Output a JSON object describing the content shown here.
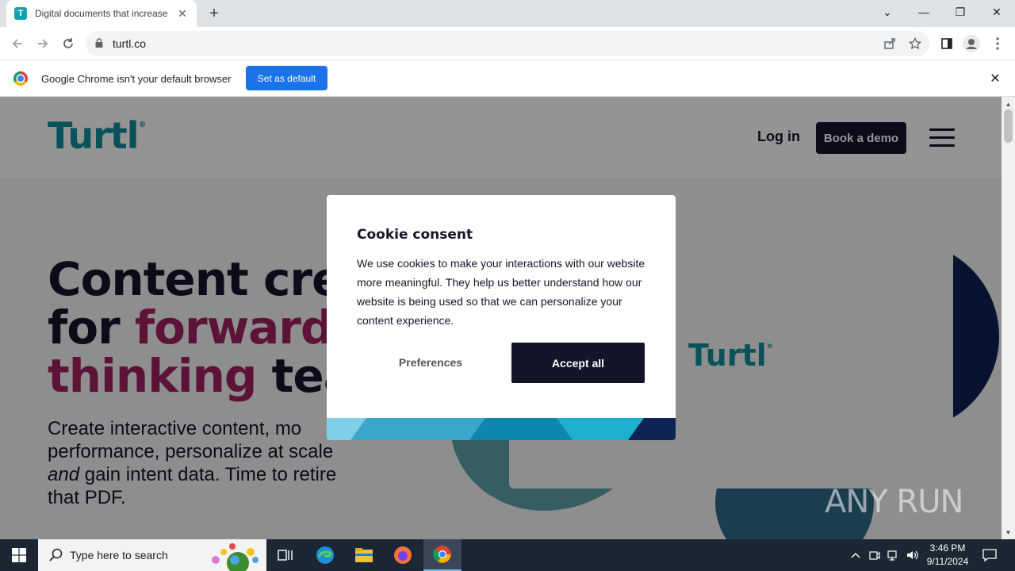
{
  "browser": {
    "tab": {
      "favicon_letter": "T",
      "title": "Digital documents that increase",
      "close": "✕"
    },
    "new_tab": "+",
    "window_controls": {
      "minimize": "—",
      "maximize": "❐",
      "close": "✕",
      "tab_search": "⌄"
    },
    "url": "turtl.co"
  },
  "infobar": {
    "message": "Google Chrome isn't your default browser",
    "button": "Set as default",
    "close": "✕"
  },
  "site": {
    "logo": "Turtl",
    "logo_mark": "®",
    "nav": {
      "login": "Log in",
      "demo": "Book a demo"
    },
    "hero": {
      "title_part1": "Content crea",
      "title_part2": "for ",
      "title_accent1": "forward-",
      "title_accent2": "thinking",
      "title_part3": " team",
      "subtitle_part1": "Create interactive content, mo",
      "subtitle_part2": "performance, personalize at scale",
      "subtitle_em": "and",
      "subtitle_part3": " gain intent data. Time to retire",
      "subtitle_part4": "that PDF."
    },
    "card_logo": "Turtl"
  },
  "cookie_modal": {
    "title": "Cookie consent",
    "body": "We use cookies to make your interactions with our website more meaningful. They help us better understand how our website is being used so that we can personalize your content experience.",
    "preferences": "Preferences",
    "accept": "Accept all"
  },
  "watermark": "ANY RUN",
  "taskbar": {
    "search_placeholder": "Type here to search",
    "time": "3:46 PM",
    "date": "9/11/2024"
  },
  "colors": {
    "brand_teal": "#0f8f9a",
    "navy": "#14142b",
    "accent": "#a0225f",
    "chrome_blue": "#1a73e8"
  }
}
